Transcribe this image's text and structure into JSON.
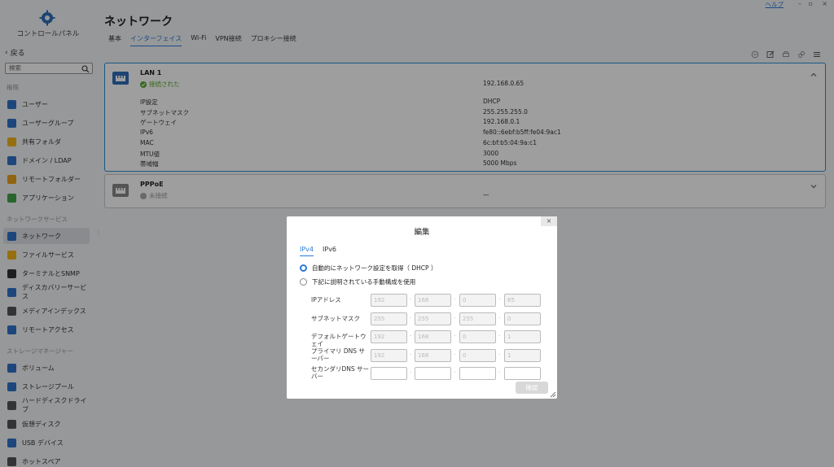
{
  "sidebar": {
    "title": "コントロールパネル",
    "back": "戻る",
    "search_placeholder": "検索",
    "section_rights": "権限",
    "section_network": "ネットワークサービス",
    "section_storage": "ストレージマネージャー",
    "items": [
      {
        "label": "ユーザー",
        "icon": "user-icon",
        "color": "#2f73c9"
      },
      {
        "label": "ユーザーグループ",
        "icon": "user-group-icon",
        "color": "#2f73c9"
      },
      {
        "label": "共有フォルダ",
        "icon": "folder-icon",
        "color": "#f2b31c"
      },
      {
        "label": "ドメイン / LDAP",
        "icon": "domain-icon",
        "color": "#2f73c9"
      },
      {
        "label": "リモートフォルダー",
        "icon": "remote-folder-icon",
        "color": "#e8a21a"
      },
      {
        "label": "アプリケーション",
        "icon": "app-icon",
        "color": "#3fa44a"
      },
      {
        "label": "ネットワーク",
        "icon": "network-icon",
        "color": "#2f73c9"
      },
      {
        "label": "ファイルサービス",
        "icon": "file-service-icon",
        "color": "#f2b31c"
      },
      {
        "label": "ターミナルとSNMP",
        "icon": "terminal-icon",
        "color": "#333333"
      },
      {
        "label": "ディスカバリーサービス",
        "icon": "discovery-icon",
        "color": "#2f73c9"
      },
      {
        "label": "メディアインデックス",
        "icon": "media-index-icon",
        "color": "#555555"
      },
      {
        "label": "リモートアクセス",
        "icon": "remote-access-icon",
        "color": "#2f73c9"
      },
      {
        "label": "ボリューム",
        "icon": "volume-icon",
        "color": "#2f73c9"
      },
      {
        "label": "ストレージプール",
        "icon": "storage-pool-icon",
        "color": "#2f73c9"
      },
      {
        "label": "ハードディスクドライブ",
        "icon": "hdd-icon",
        "color": "#555555"
      },
      {
        "label": "仮想ディスク",
        "icon": "virtual-disk-icon",
        "color": "#555555"
      },
      {
        "label": "USB デバイス",
        "icon": "usb-icon",
        "color": "#2f73c9"
      },
      {
        "label": "ホットスペア",
        "icon": "hot-spare-icon",
        "color": "#555555"
      }
    ]
  },
  "header": {
    "title": "ネットワーク",
    "help": "ヘルプ",
    "tabs": [
      "基本",
      "インターフェイス",
      "Wi-Fi",
      "VPN接続",
      "プロキシー接続"
    ],
    "active_tab": "インターフェイス"
  },
  "lan": {
    "name": "LAN 1",
    "status": "接続された",
    "status_color": "#5aa832",
    "ip": "192.168.0.65",
    "details": [
      {
        "k": "IP設定",
        "v": "DHCP"
      },
      {
        "k": "サブネットマスク",
        "v": "255.255.255.0"
      },
      {
        "k": "ゲートウェイ",
        "v": "192.168.0.1"
      },
      {
        "k": "IPv6",
        "v": "fe80::6ebf:b5ff:fe04:9ac1"
      },
      {
        "k": "MAC",
        "v": "6c:bf:b5:04:9a:c1"
      },
      {
        "k": "MTU値",
        "v": "3000"
      },
      {
        "k": "帯域幅",
        "v": "5000 Mbps"
      }
    ]
  },
  "pppoe": {
    "name": "PPPoE",
    "status": "未接続",
    "ip": "—"
  },
  "modal": {
    "title": "編集",
    "close": "×",
    "tabs": [
      "IPv4",
      "IPv6"
    ],
    "radio_auto": "自動的にネットワーク設定を取得（ DHCP ）",
    "radio_manual": "下記に説明されている手動構成を使用",
    "fields": [
      {
        "label": "IPアドレス",
        "values": [
          "192",
          "168",
          "0",
          "65"
        ]
      },
      {
        "label": "サブネットマスク",
        "values": [
          "255",
          "255",
          "255",
          "0"
        ]
      },
      {
        "label": "デフォルトゲートウェイ",
        "values": [
          "192",
          "168",
          "0",
          "1"
        ]
      },
      {
        "label": "プライマリ DNS サーバー",
        "values": [
          "192",
          "168",
          "0",
          "1"
        ]
      },
      {
        "label": "セカンダリDNS サーバー",
        "values": [
          "",
          "",
          "",
          ""
        ]
      }
    ],
    "confirm": "確認"
  }
}
